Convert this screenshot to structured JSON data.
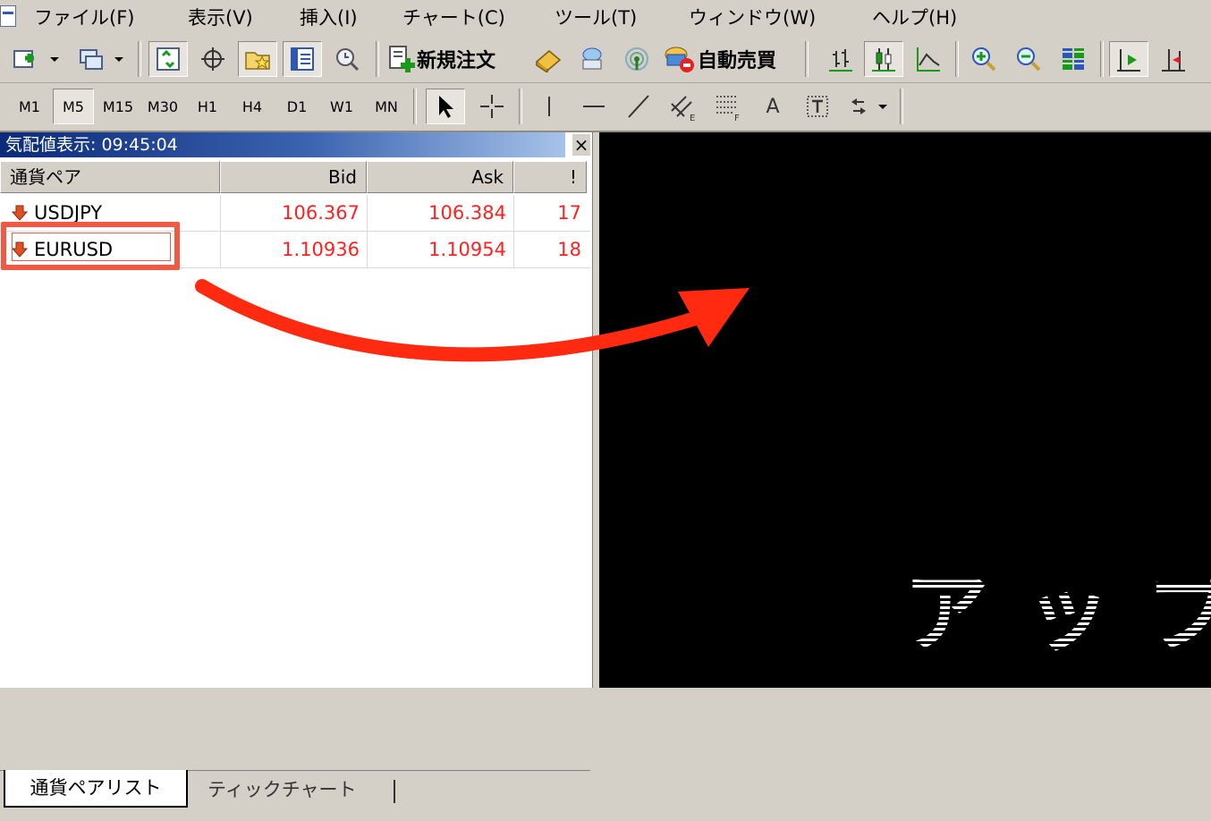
{
  "menu": {
    "items": [
      "ファイル(F)",
      "表示(V)",
      "挿入(I)",
      "チャート(C)",
      "ツール(T)",
      "ウィンドウ(W)",
      "ヘルプ(H)"
    ]
  },
  "toolbar": {
    "new_order_label": "新規注文",
    "auto_trade_label": "自動売買"
  },
  "timeframes": [
    "M1",
    "M5",
    "M15",
    "M30",
    "H1",
    "H4",
    "D1",
    "W1",
    "MN"
  ],
  "timeframe_selected": "M5",
  "draw_tools": {
    "text_tool_label": "A"
  },
  "market_watch": {
    "title": "気配値表示: 09:45:04",
    "close_label": "×",
    "columns": {
      "symbol": "通貨ペア",
      "bid": "Bid",
      "ask": "Ask",
      "spread": "!"
    },
    "rows": [
      {
        "symbol": "USDJPY",
        "bid": "106.367",
        "ask": "106.384",
        "spread": "17"
      },
      {
        "symbol": "EURUSD",
        "bid": "1.10936",
        "ask": "1.10954",
        "spread": "18"
      }
    ],
    "tabs": {
      "active": "通貨ペアリスト",
      "inactive": "ティックチャート"
    }
  },
  "chart": {
    "overlay_text": "アップ"
  },
  "colors": {
    "price_red": "#ff2020",
    "highlight_box": "#f05a45",
    "arrow": "#ff2a10",
    "chart_bg": "#000000"
  }
}
